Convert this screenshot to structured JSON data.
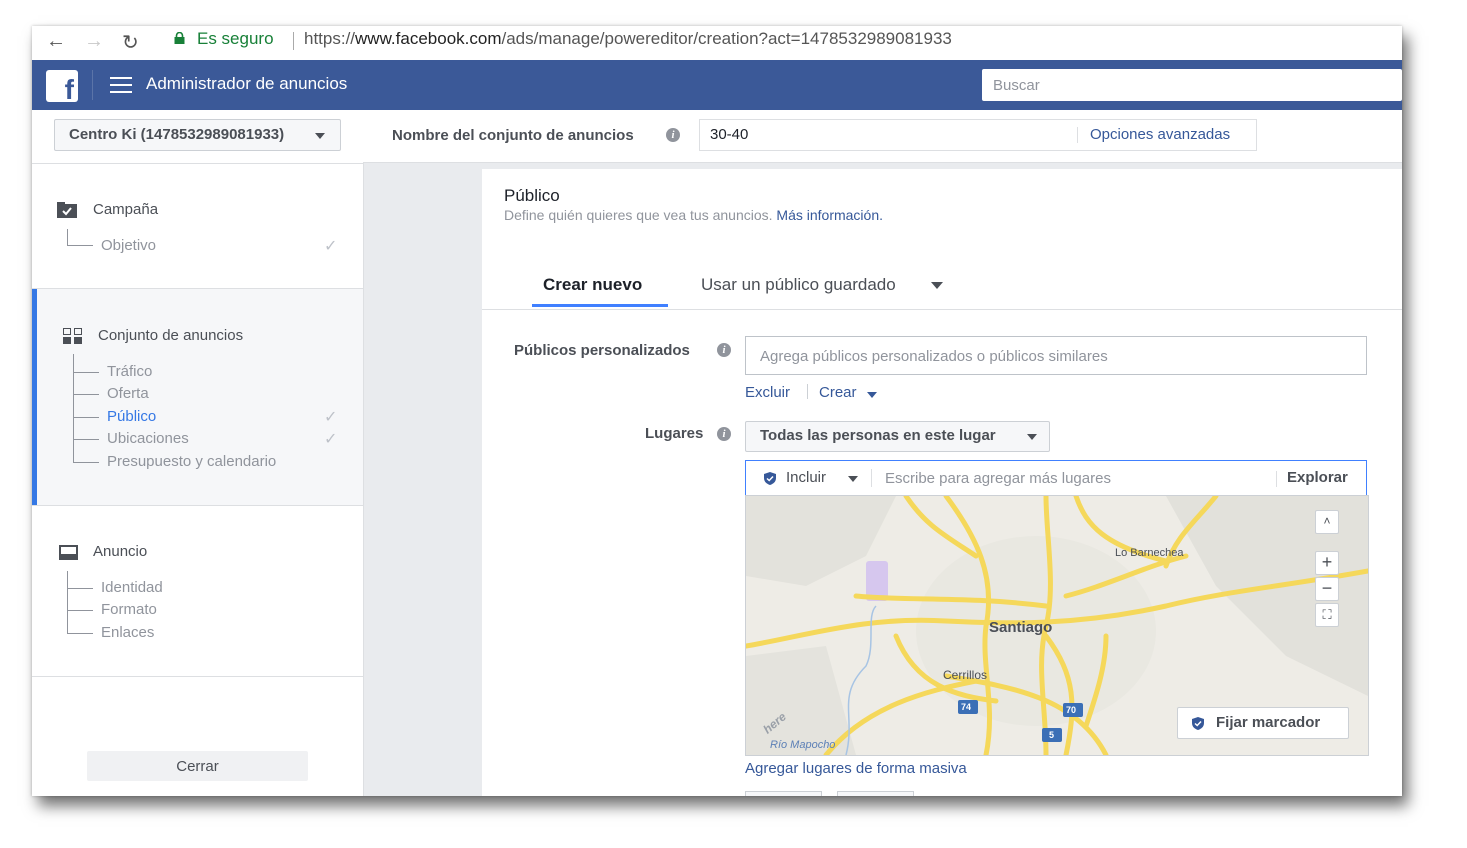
{
  "browser": {
    "secure_label": "Es seguro",
    "url_prefix": "https://",
    "url_host": "www.facebook.com",
    "url_path": "/ads/manage/powereditor/creation?act=1478532989081933"
  },
  "header": {
    "logo_letter": "f",
    "title": "Administrador de anuncios",
    "search_placeholder": "Buscar"
  },
  "account_selector": {
    "label": "Centro Ki (1478532989081933)"
  },
  "adset_name": {
    "label": "Nombre del conjunto de anuncios",
    "value": "30-40",
    "advanced_link": "Opciones avanzadas"
  },
  "sidebar": {
    "campaign": {
      "title": "Campaña",
      "items": [
        "Objetivo"
      ]
    },
    "adset": {
      "title": "Conjunto de anuncios",
      "items": [
        "Tráfico",
        "Oferta",
        "Público",
        "Ubicaciones",
        "Presupuesto y calendario"
      ]
    },
    "ad": {
      "title": "Anuncio",
      "items": [
        "Identidad",
        "Formato",
        "Enlaces"
      ]
    },
    "close_label": "Cerrar"
  },
  "audience": {
    "title": "Público",
    "description": "Define quién quieres que vea tus anuncios.",
    "more_info_link": "Más información.",
    "tab_new": "Crear nuevo",
    "tab_saved": "Usar un público guardado",
    "custom_audiences_label": "Públicos personalizados",
    "custom_audiences_placeholder": "Agrega públicos personalizados o públicos similares",
    "exclude_link": "Excluir",
    "create_link": "Crear",
    "places_label": "Lugares",
    "places_dropdown": "Todas las personas en este lugar",
    "include_label": "Incluir",
    "places_placeholder": "Escribe para agregar más lugares",
    "explore_label": "Explorar",
    "bulk_places_link": "Agregar lugares de forma masiva"
  },
  "map": {
    "labels": {
      "city": "Santiago",
      "lo_barnechea": "Lo Barnechea",
      "cerrillos": "Cerrillos",
      "rio": "Río Mapocho",
      "here": "here"
    },
    "route_shields": [
      "74",
      "70",
      "5"
    ],
    "zoom_in": "+",
    "zoom_out": "−",
    "pin_button": "Fijar marcador"
  },
  "colors": {
    "facebook_blue": "#3b5998",
    "link_blue": "#365899",
    "active_blue": "#3578e5",
    "road_yellow": "#f7dc5f"
  }
}
